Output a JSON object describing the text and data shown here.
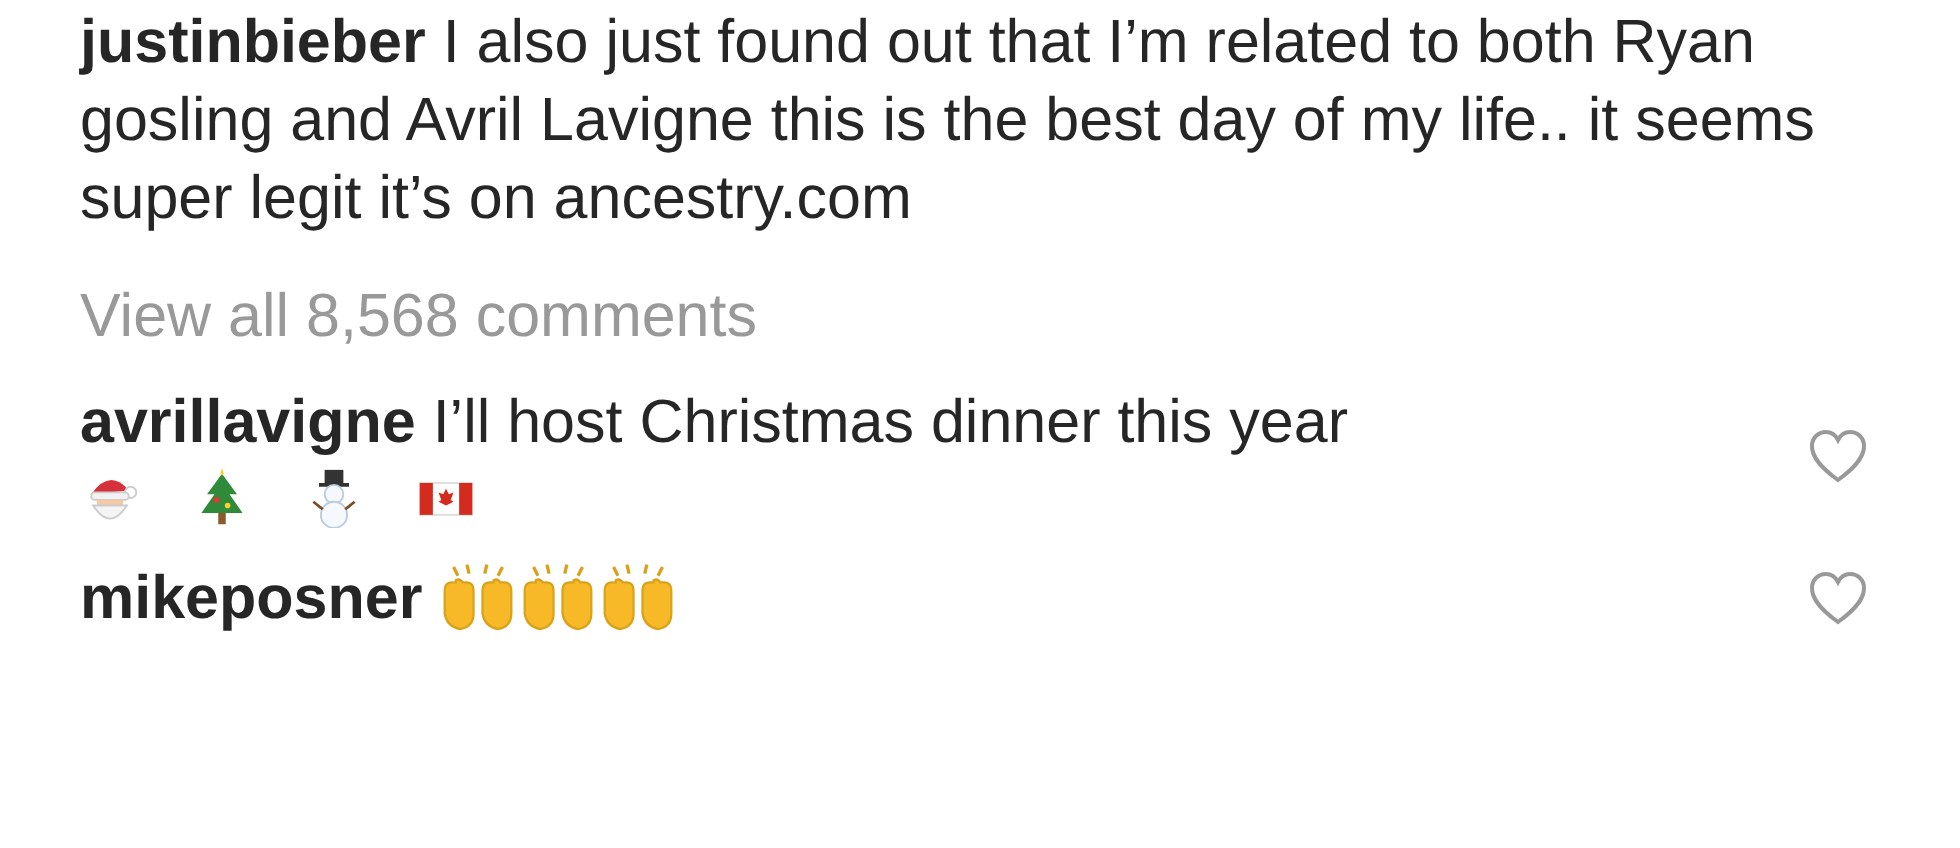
{
  "caption": {
    "text": "**justinbieber** I also just found out that I’m related to both Ryan gosling and Avril Lavigne this is the best day of my life.. it seems super legit it’s on ancestry.com"
  },
  "view_all": "View all 8,568 comments",
  "comments": [
    {
      "text": "**avrillavigne** I’ll host Christmas dinner this year",
      "emojis": [
        {
          "kind": "santa"
        },
        {
          "kind": "tree"
        },
        {
          "kind": "snowman"
        },
        {
          "kind": "canada-flag"
        }
      ]
    },
    {
      "text": "**mikeposner**",
      "emojis": [
        {
          "kind": "raised-hands"
        },
        {
          "kind": "raised-hands"
        },
        {
          "kind": "raised-hands"
        }
      ]
    }
  ]
}
